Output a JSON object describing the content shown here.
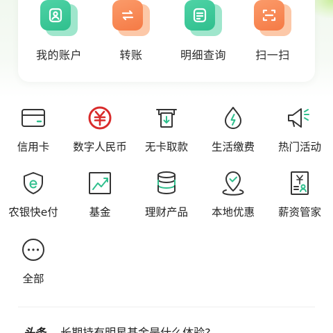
{
  "quick_actions": [
    {
      "label": "我的账户",
      "icon": "account-icon"
    },
    {
      "label": "转账",
      "icon": "transfer-icon"
    },
    {
      "label": "明细查询",
      "icon": "details-icon"
    },
    {
      "label": "扫一扫",
      "icon": "scan-icon"
    }
  ],
  "services": [
    {
      "label": "信用卡",
      "icon": "credit-card-icon"
    },
    {
      "label": "数字人民币",
      "icon": "digital-rmb-icon"
    },
    {
      "label": "无卡取款",
      "icon": "cardless-withdraw-icon"
    },
    {
      "label": "生活缴费",
      "icon": "utility-payment-icon"
    },
    {
      "label": "热门活动",
      "icon": "megaphone-icon"
    },
    {
      "label": "农银快e付",
      "icon": "e-pay-icon"
    },
    {
      "label": "基金",
      "icon": "fund-chart-icon"
    },
    {
      "label": "理财产品",
      "icon": "coin-stack-icon"
    },
    {
      "label": "本地优惠",
      "icon": "location-pin-icon"
    },
    {
      "label": "薪资管家",
      "icon": "salary-doc-icon"
    },
    {
      "label": "全部",
      "icon": "more-icon"
    }
  ],
  "headline": {
    "tag": "头条",
    "text": "长期持有明星基金是什么体验?"
  },
  "colors": {
    "brand_green": "#2fbf8d",
    "brand_orange": "#f57a45",
    "icon_stroke": "#333333",
    "icon_red": "#d92b2b"
  }
}
